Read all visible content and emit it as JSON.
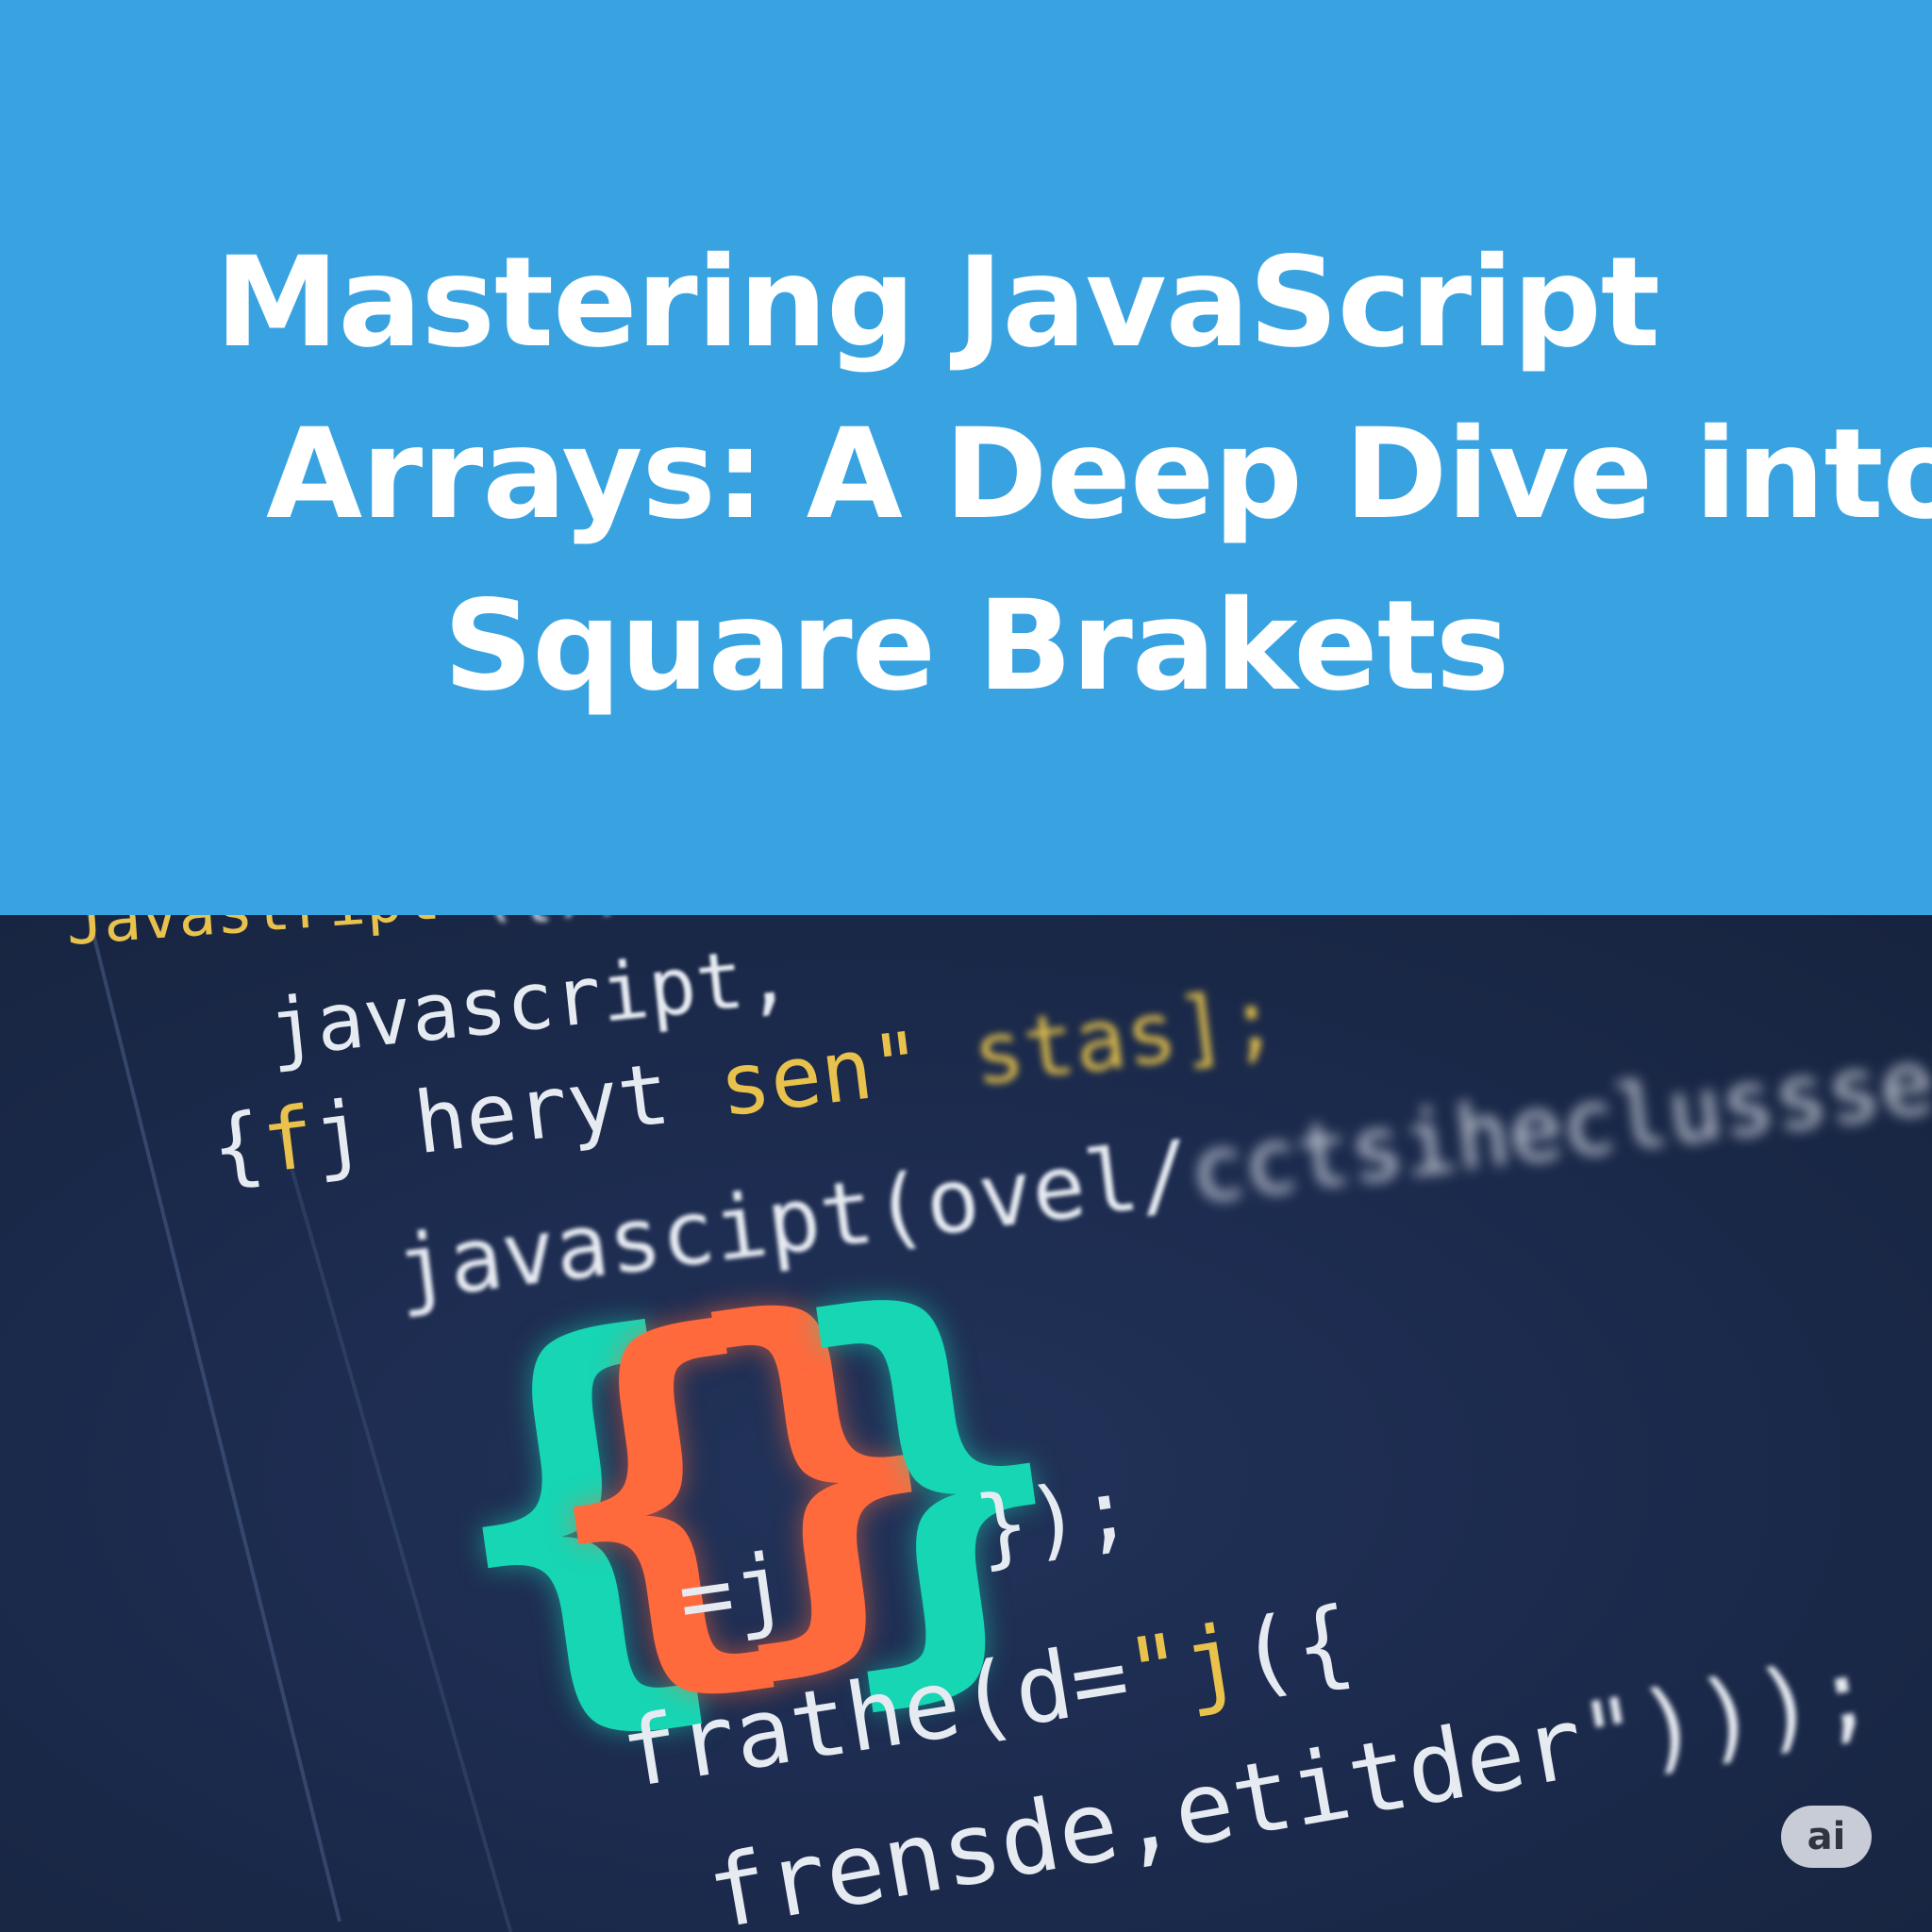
{
  "title": {
    "line1": "Mastering JavaScript",
    "line2": "Arrays: A Deep Dive into",
    "line3": "Square Brakets"
  },
  "code_lines": {
    "line1": {
      "text": "Javastript",
      "rest": "({),"
    },
    "line2": {
      "text": "javascr",
      "rest": "ipt,"
    },
    "line3": {
      "a": "{",
      "b": "f",
      "c": "j heryt ",
      "d": "sen\"",
      "e": " stas];"
    },
    "line4": {
      "a": "javascipt(ovel/",
      "b": "cctsiheclussse\"()"
    },
    "line5": {
      "text": "});"
    },
    "line6": {
      "text": "=j"
    },
    "line7": {
      "a": "frathe(d=",
      "b": "\"j",
      "c": "({"
    },
    "line8": {
      "a": "frensde,etitder",
      "b": "\")));"
    }
  },
  "big_brackets": {
    "outer_left": "{",
    "inner_left": "{",
    "inner_right": "}",
    "outer_right": "}"
  },
  "badge": {
    "label": "ai"
  },
  "colors": {
    "hero_background": "#39a3e2",
    "code_background": "#1b2a4c",
    "teal_bracket": "#17d6b4",
    "orange_bracket": "#ff6a3d",
    "keyword_yellow": "#e8c24c"
  }
}
